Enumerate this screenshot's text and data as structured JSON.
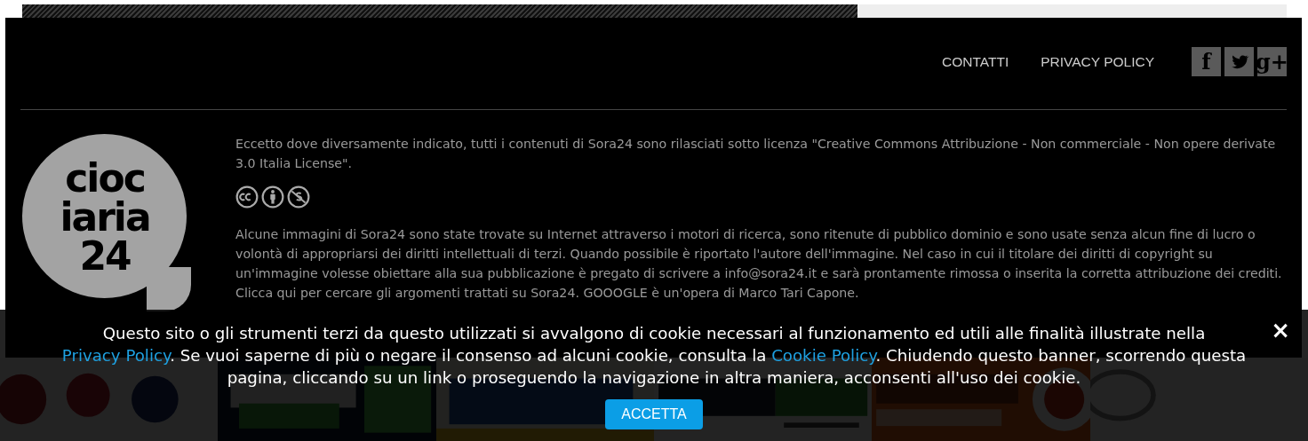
{
  "nav": {
    "links": [
      "CONTATTI",
      "PRIVACY POLICY"
    ],
    "social": [
      {
        "kind": "facebook",
        "glyph": "f"
      },
      {
        "kind": "twitter"
      },
      {
        "kind": "googleplus",
        "glyph": "g+"
      }
    ]
  },
  "logo": {
    "lines": [
      "cioc",
      "iaria",
      "24"
    ]
  },
  "license_text": "Eccetto dove diversamente indicato, tutti i contenuti di Sora24 sono rilasciati sotto licenza \"Creative Commons Attribuzione - Non commerciale - Non opere derivate 3.0 Italia License\".",
  "license_icons": [
    {
      "kind": "cc"
    },
    {
      "kind": "by"
    },
    {
      "kind": "nc"
    }
  ],
  "disclaimer": "Alcune immagini di Sora24 sono state trovate su Internet attraverso i motori di ricerca, sono ritenute di pubblico dominio e sono usate senza alcun fine di lucro o volontà di appropriarsi dei diritti intellettuali di terzi. Quando possibile è riportato l'autore dell'immagine. Nel caso in cui il titolare dei diritti di copyright su un'immagine volesse obiettare alla sua pubblicazione è pregato di scrivere a info@sora24.it e sarà prontamente rimossa o inserita la corretta attribuzione dei crediti. Clicca qui per cercare gli argomenti trattati su Sora24. GOOOGLE è un'opera di Marco Tari Capone.",
  "cookie_banner": {
    "parts": [
      {
        "kind": "text",
        "text": "Questo sito o gli strumenti terzi da questo utilizzati si avvalgono di cookie necessari al funzionamento ed utili alle finalità illustrate nella "
      },
      {
        "kind": "link",
        "text": "Privacy Policy"
      },
      {
        "kind": "text",
        "text": ". Se vuoi saperne di più o negare il consenso ad alcuni cookie, consulta la "
      },
      {
        "kind": "link",
        "text": "Cookie Policy"
      },
      {
        "kind": "text",
        "text": ". Chiudendo questo banner, scorrendo questa pagina, cliccando su un link o proseguendo la navigazione in altra maniera, acconsenti all'uso dei cookie."
      }
    ],
    "accept": "ACCETTA",
    "close": "×"
  }
}
